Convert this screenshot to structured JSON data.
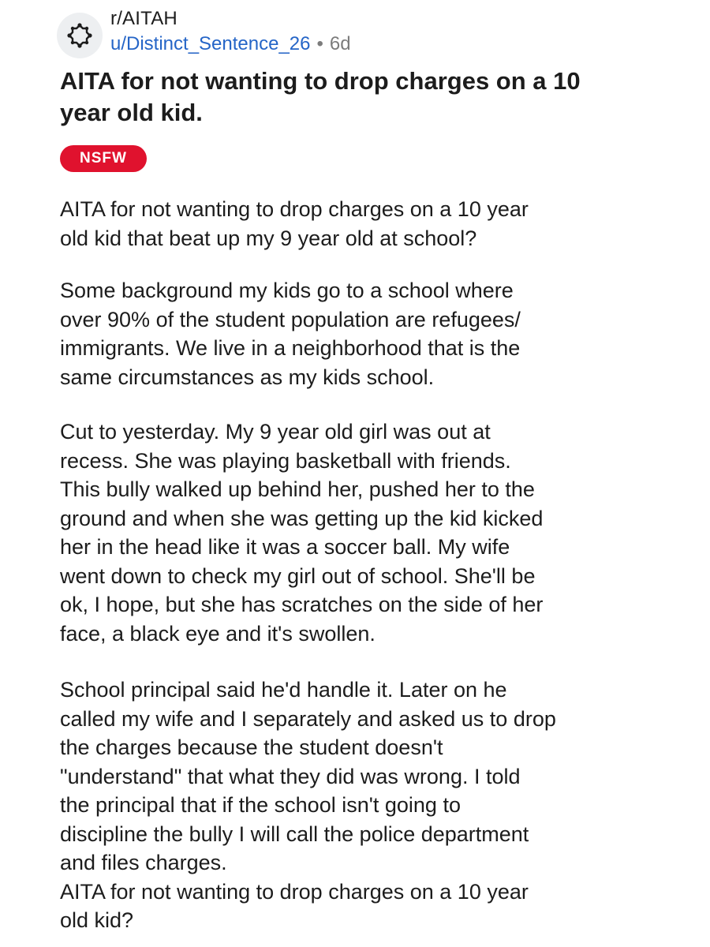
{
  "post": {
    "subreddit": "r/AITAH",
    "author": "u/Distinct_Sentence_26",
    "separator": "•",
    "age": "6d",
    "title": "AITA for not wanting to drop charges on a 10\nyear old kid.",
    "tag": "NSFW",
    "tag_color": "#e0122e",
    "avatar_icon": "snoo-placeholder-icon",
    "body": {
      "p1": "AITA for not wanting to drop charges on a 10 year\nold kid that beat up my 9 year old at school?",
      "p2": "Some background my kids go to a school where\nover 90% of the student population are refugees/\nimmigrants.  We live in a neighborhood that is the\nsame circumstances as my kids school.",
      "p3": "Cut to yesterday. My 9 year old girl was out at\nrecess. She was playing basketball with friends.\nThis bully walked  up behind her, pushed her to the\nground and when she was getting up the kid kicked\nher in the head like it was a soccer ball.   My wife\nwent down to check my girl out of school. She'll be\nok, I hope, but she has scratches on the side of her\nface, a black eye and it's swollen.",
      "p4": "School principal said he'd handle it. Later on he\ncalled my wife and I separately and asked us to drop\nthe charges because the student doesn't\n\"understand\" that what they did was wrong.   I told\nthe principal that if the school isn't going to\ndiscipline the bully I will call the police department\nand files charges.\nAITA for not wanting to drop charges on a 10 year\nold kid?"
    }
  }
}
